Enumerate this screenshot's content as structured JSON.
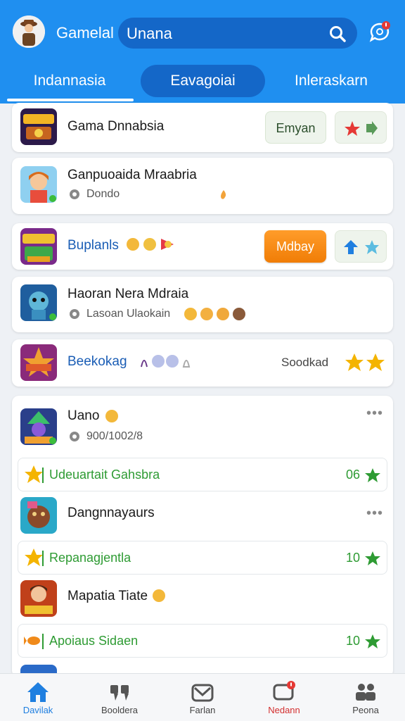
{
  "header": {
    "title": "Gamelal",
    "search_value": "Unana"
  },
  "tabs": [
    {
      "label": "Indannasia"
    },
    {
      "label": "Eavagoiai"
    },
    {
      "label": "Inleraskarn"
    }
  ],
  "cards": [
    {
      "title": "Gama Dnnabsia",
      "button": "Emyan"
    },
    {
      "title": "Ganpuoaida Mraabria",
      "subtitle": "Dondo"
    },
    {
      "title": "Buplanls",
      "button": "Mdbay"
    },
    {
      "title": "Haoran Nera Mdraia",
      "subtitle": "Lasoan Ulaokain"
    },
    {
      "title": "Beekokag",
      "side_text": "Soodkad"
    }
  ],
  "group": {
    "items": [
      {
        "title": "Uano",
        "subtitle": "900/1002/8"
      },
      {
        "title": "Dangnnayaurs"
      },
      {
        "title": "Mapatia Tiate"
      }
    ],
    "rewards": [
      {
        "label": "Udeuartait Gahsbra",
        "value": "06"
      },
      {
        "label": "Repanagjentla",
        "value": "10"
      },
      {
        "label": "Apoiaus Sidaen",
        "value": "10"
      }
    ]
  },
  "bottom_nav": [
    {
      "label": "Davilak",
      "active": true
    },
    {
      "label": "Booldera"
    },
    {
      "label": "Farlan"
    },
    {
      "label": "Nedann"
    },
    {
      "label": "Peona"
    }
  ],
  "colors": {
    "accent": "#1f8ff0",
    "accent_dark": "#1467c8",
    "reward_green": "#2e9b33",
    "active_nav": "#1f7fe0",
    "alert_red": "#e53935"
  }
}
